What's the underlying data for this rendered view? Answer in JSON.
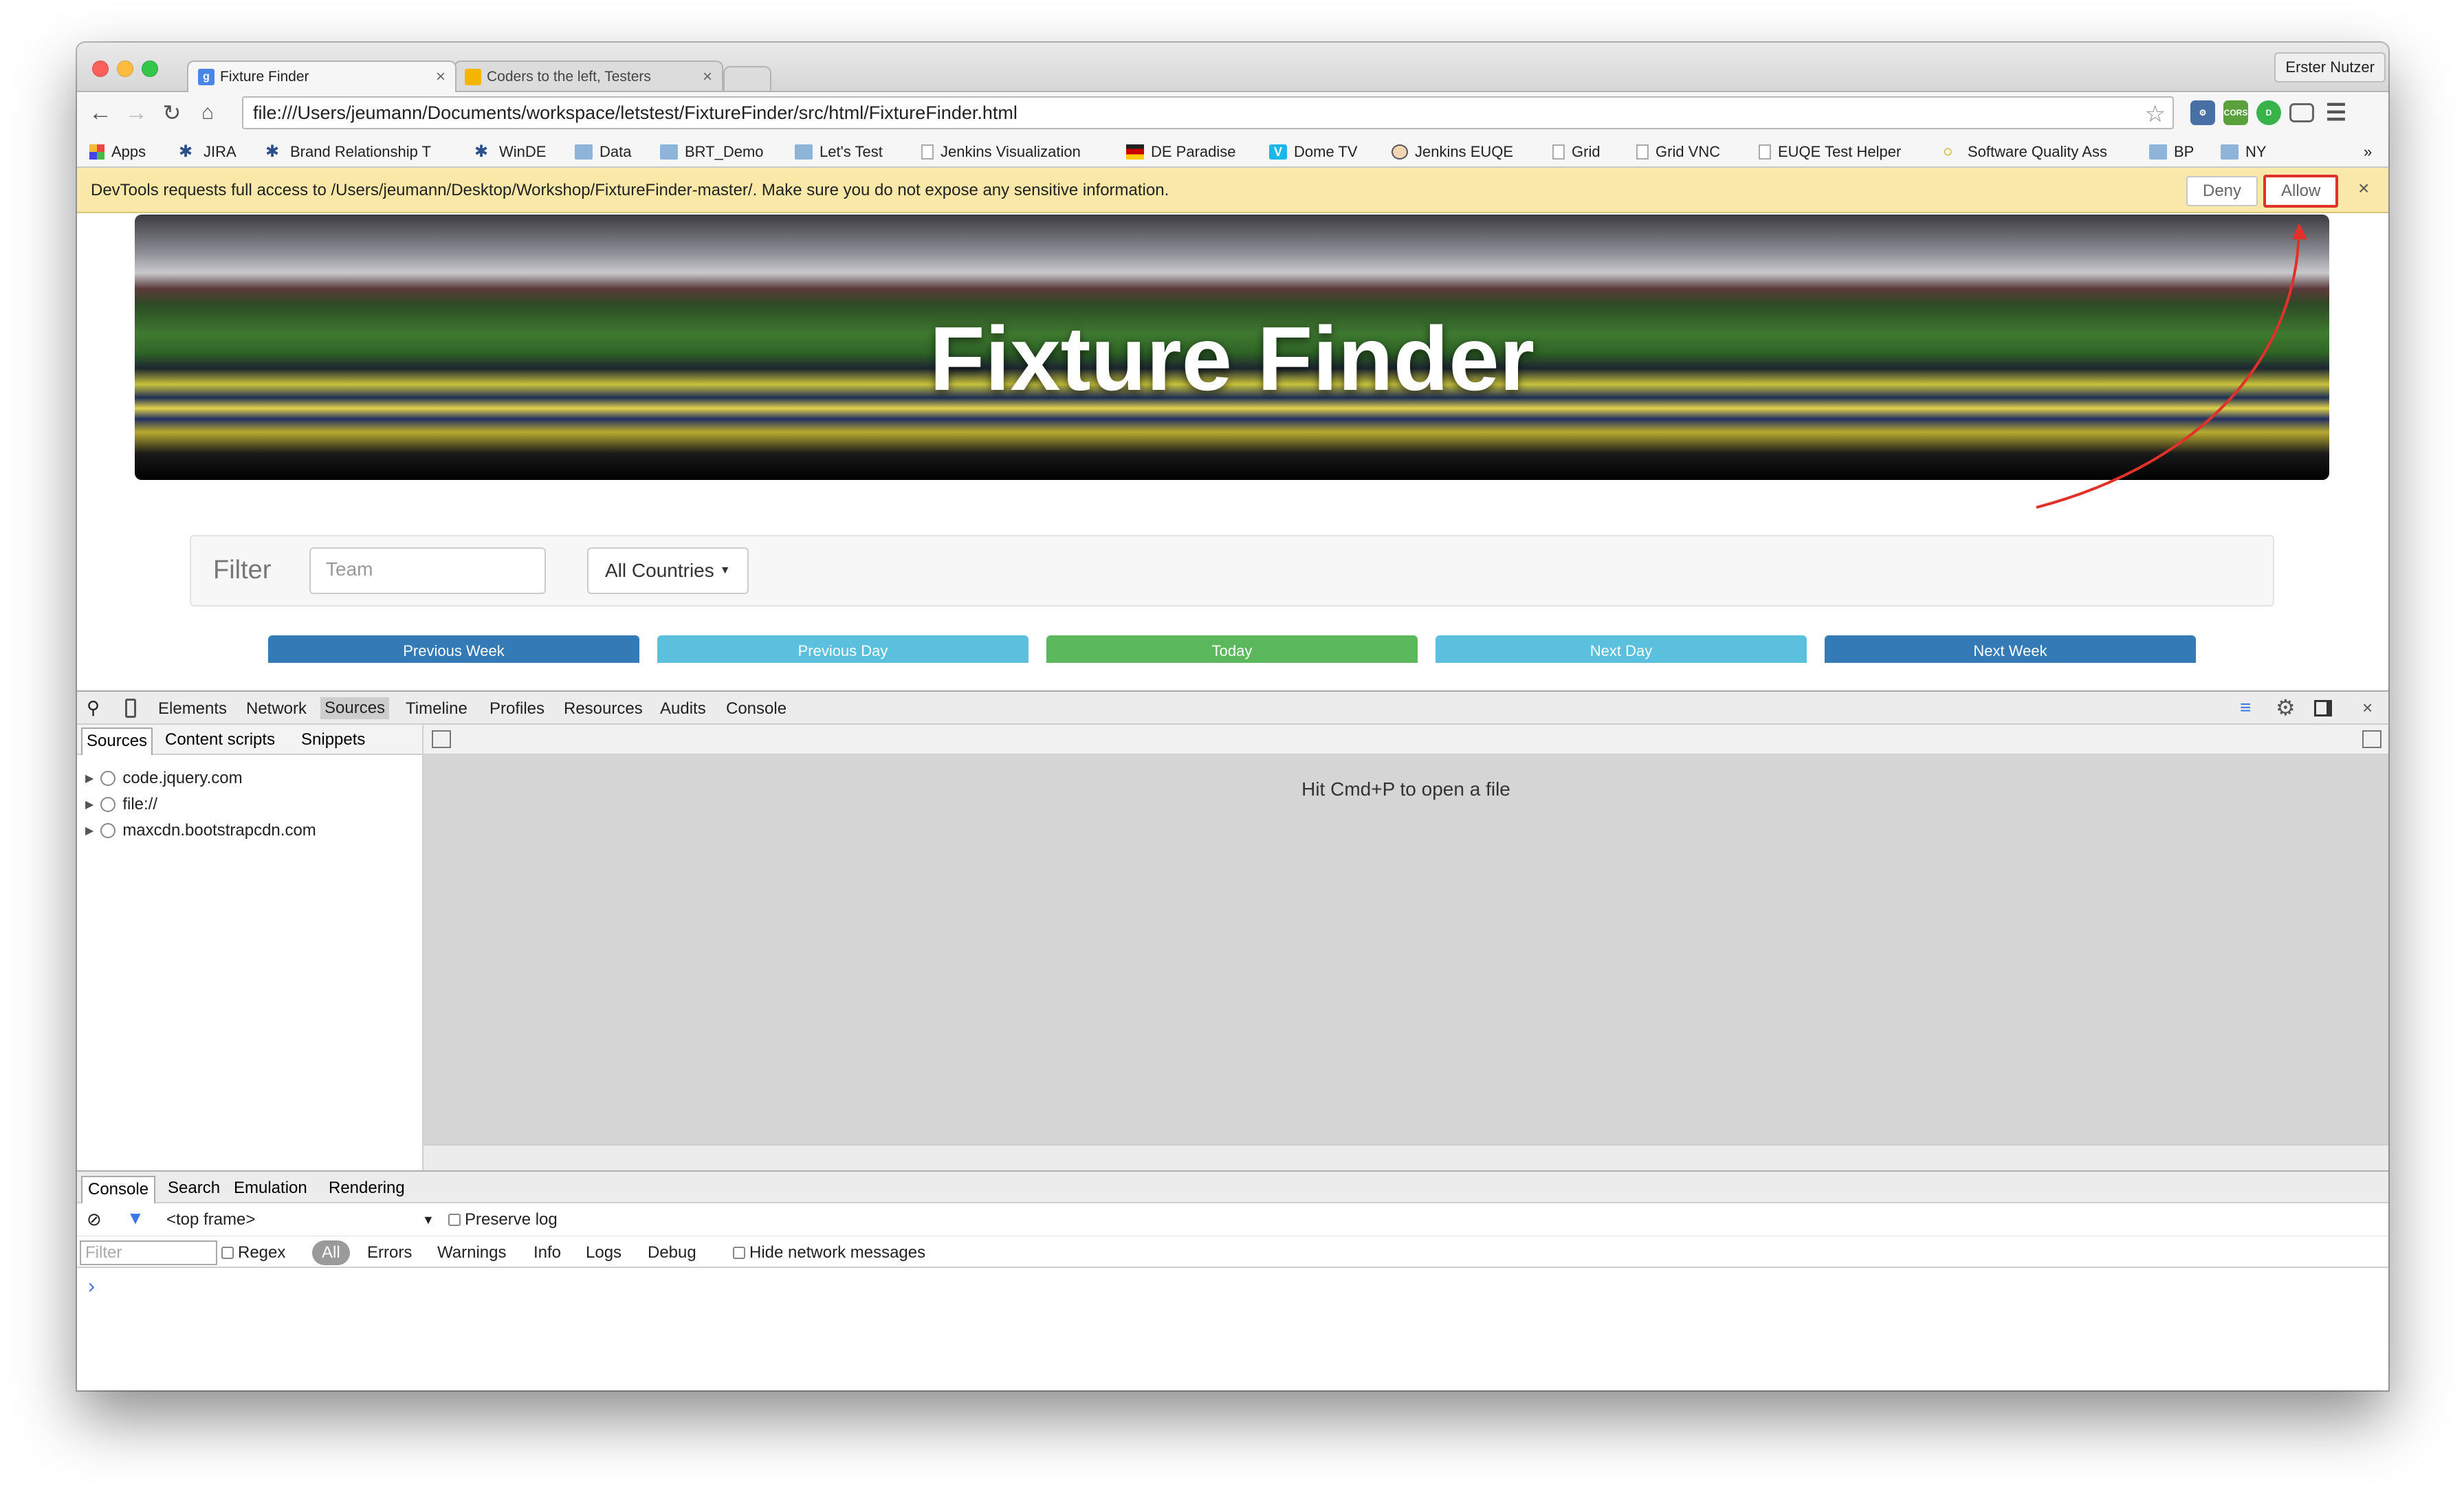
{
  "browser": {
    "tabs": [
      {
        "title": "Fixture Finder",
        "active": true
      },
      {
        "title": "Coders to the left, Testers",
        "active": false
      }
    ],
    "user_button": "Erster Nutzer",
    "url": "file:///Users/jeumann/Documents/workspace/letstest/FixtureFinder/src/html/FixtureFinder.html",
    "extensions": [
      "pedal-icon",
      "cors-icon",
      "odigo-icon",
      "cast-icon",
      "menu-icon"
    ],
    "bookmarks": [
      {
        "label": "Apps",
        "icon": "apps-grid-icon"
      },
      {
        "label": "JIRA",
        "icon": "jira-icon"
      },
      {
        "label": "Brand Relationship T",
        "icon": "jira-icon"
      },
      {
        "label": "WinDE",
        "icon": "jira-icon"
      },
      {
        "label": "Data",
        "icon": "folder-icon"
      },
      {
        "label": "BRT_Demo",
        "icon": "folder-icon"
      },
      {
        "label": "Let's Test",
        "icon": "folder-icon"
      },
      {
        "label": "Jenkins Visualization",
        "icon": "page-icon"
      },
      {
        "label": "DE Paradise",
        "icon": "paradise-icon"
      },
      {
        "label": "Dome TV",
        "icon": "vimeo-icon"
      },
      {
        "label": "Jenkins EUQE",
        "icon": "jenkins-icon"
      },
      {
        "label": "Grid",
        "icon": "page-icon"
      },
      {
        "label": "Grid VNC",
        "icon": "page-icon"
      },
      {
        "label": "EUQE Test Helper",
        "icon": "page-icon"
      },
      {
        "label": "Software Quality Ass",
        "icon": "bulb-icon"
      },
      {
        "label": "BP",
        "icon": "folder-icon"
      },
      {
        "label": "NY",
        "icon": "folder-icon"
      }
    ],
    "bookmarks_overflow": "»"
  },
  "infobar": {
    "message": "DevTools requests full access to /Users/jeumann/Desktop/Workshop/FixtureFinder-master/. Make sure you do not expose any sensitive information.",
    "deny": "Deny",
    "allow": "Allow",
    "close": "×"
  },
  "page": {
    "hero_title": "Fixture Finder",
    "filter_label": "Filter",
    "team_placeholder": "Team",
    "countries_dropdown": "All Countries",
    "nav_buttons": [
      {
        "label": "Previous Week",
        "color": "#337ab7"
      },
      {
        "label": "Previous Day",
        "color": "#5bc0de"
      },
      {
        "label": "Today",
        "color": "#5cb85c"
      },
      {
        "label": "Next Day",
        "color": "#5bc0de"
      },
      {
        "label": "Next Week",
        "color": "#337ab7"
      }
    ]
  },
  "devtools": {
    "tabs": [
      "Elements",
      "Network",
      "Sources",
      "Timeline",
      "Profiles",
      "Resources",
      "Audits",
      "Console"
    ],
    "selected_tab": "Sources",
    "navigator_tabs": [
      "Sources",
      "Content scripts",
      "Snippets"
    ],
    "tree": [
      "code.jquery.com",
      "file://",
      "maxcdn.bootstrapcdn.com"
    ],
    "editor_hint": "Hit Cmd+P to open a file",
    "drawer_tabs": [
      "Console",
      "Search",
      "Emulation",
      "Rendering"
    ],
    "console": {
      "frame": "<top frame>",
      "preserve_log": "Preserve log",
      "filter_placeholder": "Filter",
      "regex": "Regex",
      "levels": [
        "All",
        "Errors",
        "Warnings",
        "Info",
        "Logs",
        "Debug"
      ],
      "hide_network": "Hide network messages",
      "prompt": "›"
    }
  },
  "colors": {
    "infobar_bg": "#f9e8a8",
    "annotation_red": "#e0322a",
    "devtools_selected": "#cdcdcd"
  }
}
